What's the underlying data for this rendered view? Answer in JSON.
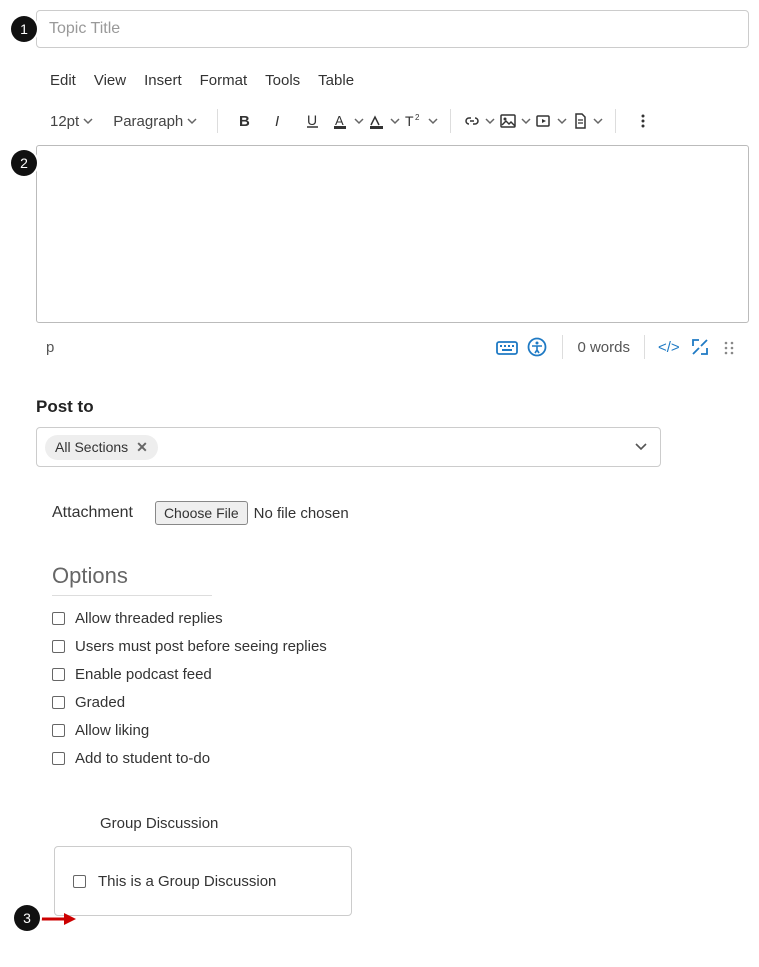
{
  "callouts": {
    "c1": "1",
    "c2": "2",
    "c3": "3"
  },
  "title": {
    "placeholder": "Topic Title",
    "value": ""
  },
  "menu": {
    "edit": "Edit",
    "view": "View",
    "insert": "Insert",
    "format": "Format",
    "tools": "Tools",
    "table": "Table"
  },
  "toolbar": {
    "font_size": "12pt",
    "block": "Paragraph"
  },
  "status": {
    "path": "p",
    "words": "0 words"
  },
  "post_to": {
    "label": "Post to",
    "chip": "All Sections"
  },
  "attachment": {
    "label": "Attachment",
    "button": "Choose File",
    "status": "No file chosen"
  },
  "options": {
    "heading": "Options",
    "items": {
      "threaded": "Allow threaded replies",
      "post_first": "Users must post before seeing replies",
      "podcast": "Enable podcast feed",
      "graded": "Graded",
      "liking": "Allow liking",
      "todo": "Add to student to-do"
    }
  },
  "group": {
    "heading": "Group Discussion",
    "checkbox_label": "This is a Group Discussion"
  }
}
